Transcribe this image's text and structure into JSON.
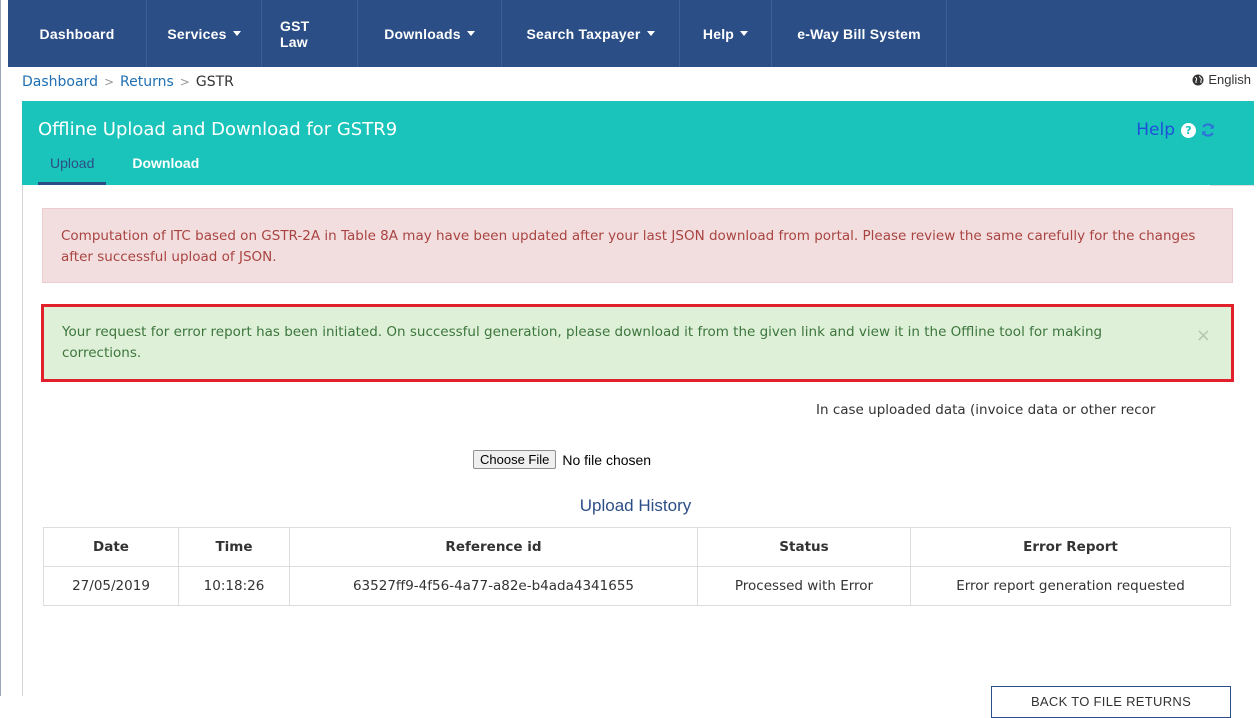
{
  "nav": {
    "items": [
      {
        "label": "Dashboard",
        "dropdown": false
      },
      {
        "label": "Services",
        "dropdown": true
      },
      {
        "label": "GST Law",
        "dropdown": false
      },
      {
        "label": "Downloads",
        "dropdown": true
      },
      {
        "label": "Search Taxpayer",
        "dropdown": true
      },
      {
        "label": "Help",
        "dropdown": true
      },
      {
        "label": "e-Way Bill System",
        "dropdown": false
      }
    ]
  },
  "breadcrumb": {
    "items": [
      "Dashboard",
      "Returns",
      "GSTR"
    ],
    "separator": ">"
  },
  "language": {
    "label": "English",
    "icon": "globe-icon"
  },
  "panel": {
    "title": "Offline Upload and Download for GSTR9",
    "help_label": "Help",
    "help_icon": "question-circle-icon",
    "refresh_icon": "refresh-icon",
    "tabs": [
      {
        "label": "Upload",
        "active": true
      },
      {
        "label": "Download",
        "active": false
      }
    ]
  },
  "alerts": {
    "warning_text": "Computation of ITC based on GSTR-2A in Table 8A may have been updated after your last JSON download from portal. Please review the same carefully for the changes after successful upload of JSON.",
    "success_text": "Your request for error report has been initiated. On successful generation, please download it from the given link and view it in the Offline tool for making corrections.",
    "close_symbol": "×"
  },
  "info_text": "In case uploaded data (invoice data or other recor",
  "file_input": {
    "button_label": "Choose File",
    "status": "No file chosen"
  },
  "upload_history": {
    "title": "Upload History",
    "columns": [
      "Date",
      "Time",
      "Reference id",
      "Status",
      "Error Report"
    ],
    "rows": [
      [
        "27/05/2019",
        "10:18:26",
        "63527ff9-4f56-4a77-a82e-b4ada4341655",
        "Processed with Error",
        "Error report generation requested"
      ]
    ]
  },
  "back_button_label": "BACK TO FILE RETURNS",
  "colors": {
    "nav_bg": "#2c4e86",
    "header_bg": "#1bc4bb",
    "alert_danger_bg": "#f2dede",
    "alert_success_bg": "#dff0d8",
    "highlight_border": "#e2202b"
  }
}
